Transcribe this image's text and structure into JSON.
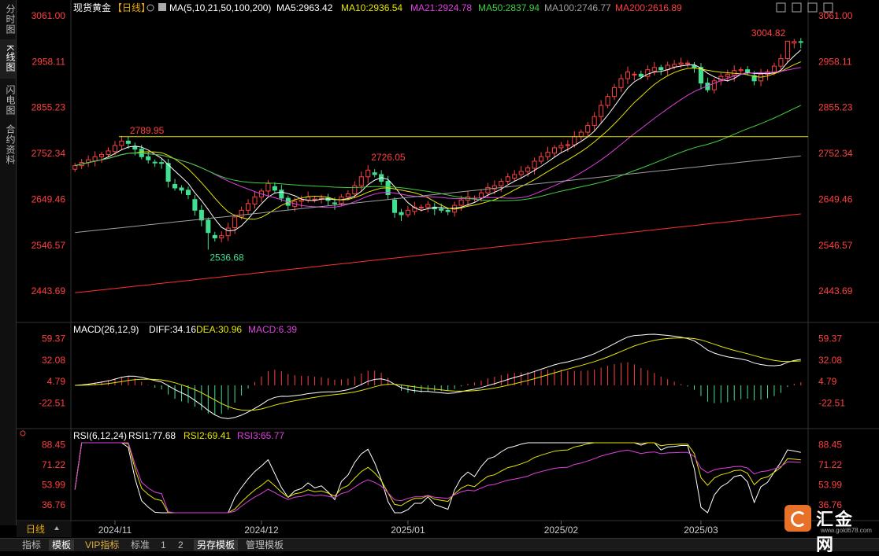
{
  "sidebar": {
    "tabs": [
      "分时图",
      "K线图",
      "闪电图",
      "合约资料"
    ],
    "active": 1
  },
  "header": {
    "instrument": "现货黄金",
    "period_tag": "【日线】",
    "ma_label": "MA(5,10,21,50,100,200)",
    "ma_values": [
      {
        "text": "MA5:2963.42",
        "color": "#ffffff"
      },
      {
        "text": "MA10:2936.54",
        "color": "#e6e600"
      },
      {
        "text": "MA21:2924.78",
        "color": "#e040e0"
      },
      {
        "text": "MA50:2837.94",
        "color": "#40d040"
      },
      {
        "text": "MA100:2746.77",
        "color": "#a0a0a0"
      },
      {
        "text": "MA200:2616.89",
        "color": "#ff4040"
      }
    ]
  },
  "price_axis": {
    "labels": [
      "3061.00",
      "2958.11",
      "2855.23",
      "2752.34",
      "2649.46",
      "2546.57",
      "2443.69"
    ]
  },
  "macd": {
    "label": "MACD(26,12,9)",
    "diff": "DIFF:34.16",
    "dea": "DEA:30.96",
    "macd": "MACD:6.39",
    "axis": [
      "59.37",
      "32.08",
      "4.79",
      "-22.51"
    ]
  },
  "rsi": {
    "label": "RSI(6,12,24)",
    "rsi1": "RSI1:77.68",
    "rsi2": "RSI2:69.41",
    "rsi3": "RSI3:65.77",
    "axis": [
      "88.45",
      "71.22",
      "53.99",
      "36.76"
    ]
  },
  "annotations": {
    "high": "3004.82",
    "mid_high": "2726.05",
    "low": "2536.68",
    "line": "2789.95"
  },
  "xaxis": {
    "period": "日线",
    "labels": [
      "2024/11",
      "2024/12",
      "2025/01",
      "2025/02",
      "2025/03"
    ]
  },
  "bottom_tabs": [
    "指标",
    "模板",
    "VIP指标",
    "标准",
    "1",
    "2",
    "另存模板",
    "管理模板"
  ],
  "bottom_active": 1,
  "logo": {
    "text": "汇金网",
    "url": "www.gold678.com"
  },
  "colors": {
    "up": "#ff4040",
    "down": "#40e090",
    "ma5": "#ffffff",
    "ma10": "#e6e600",
    "ma21": "#e040e0",
    "ma50": "#40d040",
    "ma100": "#a0a0a0",
    "ma200": "#ff3030",
    "axis": "#ff4040",
    "hline": "#e6e600"
  },
  "chart_data": {
    "type": "candlestick",
    "y_range": [
      2400,
      3061
    ],
    "series_close": [
      2725,
      2732,
      2738,
      2745,
      2750,
      2758,
      2770,
      2780,
      2775,
      2762,
      2745,
      2738,
      2732,
      2730,
      2690,
      2675,
      2670,
      2660,
      2625,
      2603,
      2575,
      2563,
      2568,
      2585,
      2610,
      2625,
      2640,
      2655,
      2668,
      2685,
      2670,
      2652,
      2636,
      2645,
      2648,
      2655,
      2650,
      2652,
      2647,
      2640,
      2655,
      2662,
      2680,
      2700,
      2715,
      2705,
      2690,
      2660,
      2620,
      2615,
      2625,
      2632,
      2632,
      2638,
      2628,
      2625,
      2622,
      2636,
      2648,
      2655,
      2652,
      2664,
      2676,
      2680,
      2690,
      2700,
      2705,
      2712,
      2720,
      2735,
      2745,
      2755,
      2765,
      2770,
      2772,
      2790,
      2800,
      2815,
      2835,
      2860,
      2880,
      2900,
      2920,
      2935,
      2930,
      2925,
      2940,
      2945,
      2940,
      2950,
      2952,
      2955,
      2955,
      2945,
      2910,
      2895,
      2915,
      2925,
      2930,
      2938,
      2940,
      2935,
      2915,
      2930,
      2935,
      2948,
      2965,
      3004,
      3003,
      3002
    ]
  }
}
